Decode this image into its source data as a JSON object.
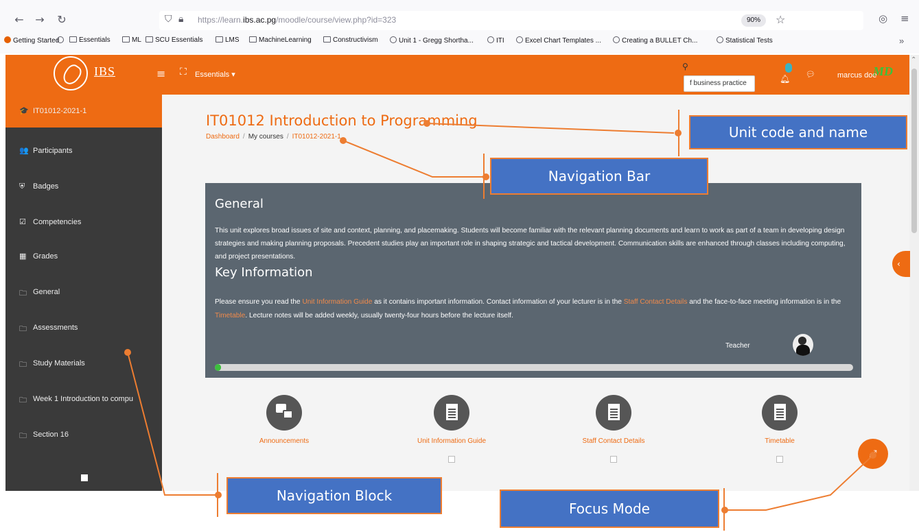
{
  "browser": {
    "url_prefix": "https://learn.",
    "url_domain": "ibs.ac.pg",
    "url_path": "/moodle/course/view.php?id=323",
    "zoom": "90%",
    "bookmarks": [
      "Getting Started",
      "Essentials",
      "ML",
      "SCU Essentials",
      "LMS",
      "MachineLearning",
      "Constructivism",
      "Unit 1 - Gregg Shortha...",
      "ITI",
      "Excel Chart Templates ...",
      "Creating a BULLET Ch...",
      "Statistical Tests"
    ],
    "bookmarks_more": "»"
  },
  "header": {
    "logo_text": "IBS",
    "essentials_menu": "Essentials ▾",
    "search_tooltip": "f business practice",
    "username": "marcus doe",
    "avatar_initials": "MD"
  },
  "sidebar": {
    "items": [
      {
        "label": "IT01012-2021-1",
        "icon": "graduation-cap-icon",
        "glyph": "🎓"
      },
      {
        "label": "Participants",
        "icon": "users-icon",
        "glyph": "👥"
      },
      {
        "label": "Badges",
        "icon": "shield-icon",
        "glyph": "⛨"
      },
      {
        "label": "Competencies",
        "icon": "checkbox-icon",
        "glyph": "☑"
      },
      {
        "label": "Grades",
        "icon": "table-icon",
        "glyph": "▦"
      },
      {
        "label": "General",
        "icon": "folder-icon",
        "glyph": "🗀"
      },
      {
        "label": "Assessments",
        "icon": "folder-icon",
        "glyph": "🗀"
      },
      {
        "label": "Study Materials",
        "icon": "folder-icon",
        "glyph": "🗀"
      },
      {
        "label": "Week 1 Introduction to compu",
        "icon": "folder-icon",
        "glyph": "🗀"
      },
      {
        "label": "Section 16",
        "icon": "folder-icon",
        "glyph": "🗀"
      }
    ]
  },
  "course": {
    "title": "IT01012 Introduction to Programming",
    "breadcrumb": {
      "dashboard": "Dashboard",
      "my_courses": "My courses",
      "course_code": "IT01012-2021-1"
    }
  },
  "general_panel": {
    "heading": "General",
    "description": "This unit explores broad issues of site and context, planning, and placemaking. Students will become familiar with the relevant planning documents and learn to work as part of a team in developing design strategies and making planning proposals. Precedent studies play an important role in shaping strategic and tactical development. Communication skills are enhanced through classes including computing, and project presentations.",
    "key_info_heading": "Key Information",
    "key_info_part1": "Please ensure you read the ",
    "key_info_link1": "Unit Information Guide",
    "key_info_part2": " as it contains important information. Contact information of your lecturer is in the ",
    "key_info_link2": "Staff Contact Details",
    "key_info_part3": " and the face-to-face meeting information is in the ",
    "key_info_link3": "Timetable",
    "key_info_part4": ". Lecture notes will be added weekly, usually twenty-four hours before the lecture itself.",
    "teacher_label": "Teacher",
    "progress_fraction": 0.01
  },
  "tiles": [
    {
      "label": "Announcements",
      "icon": "forum-icon"
    },
    {
      "label": "Unit Information Guide",
      "icon": "document-icon"
    },
    {
      "label": "Staff Contact Details",
      "icon": "document-icon"
    },
    {
      "label": "Timetable",
      "icon": "document-icon"
    }
  ],
  "focus_button": {
    "icon": "expand-arrows-icon"
  },
  "callouts": {
    "unit_code": "Unit code and name",
    "nav_bar": "Navigation Bar",
    "nav_block": "Navigation Block",
    "focus_mode": "Focus Mode"
  },
  "colors": {
    "brand": "#ee6b13",
    "sidebar_bg": "#3a3a3a",
    "panel_bg": "#5b6670",
    "callout_fill": "#4472c4",
    "callout_line": "#ed7d31"
  }
}
